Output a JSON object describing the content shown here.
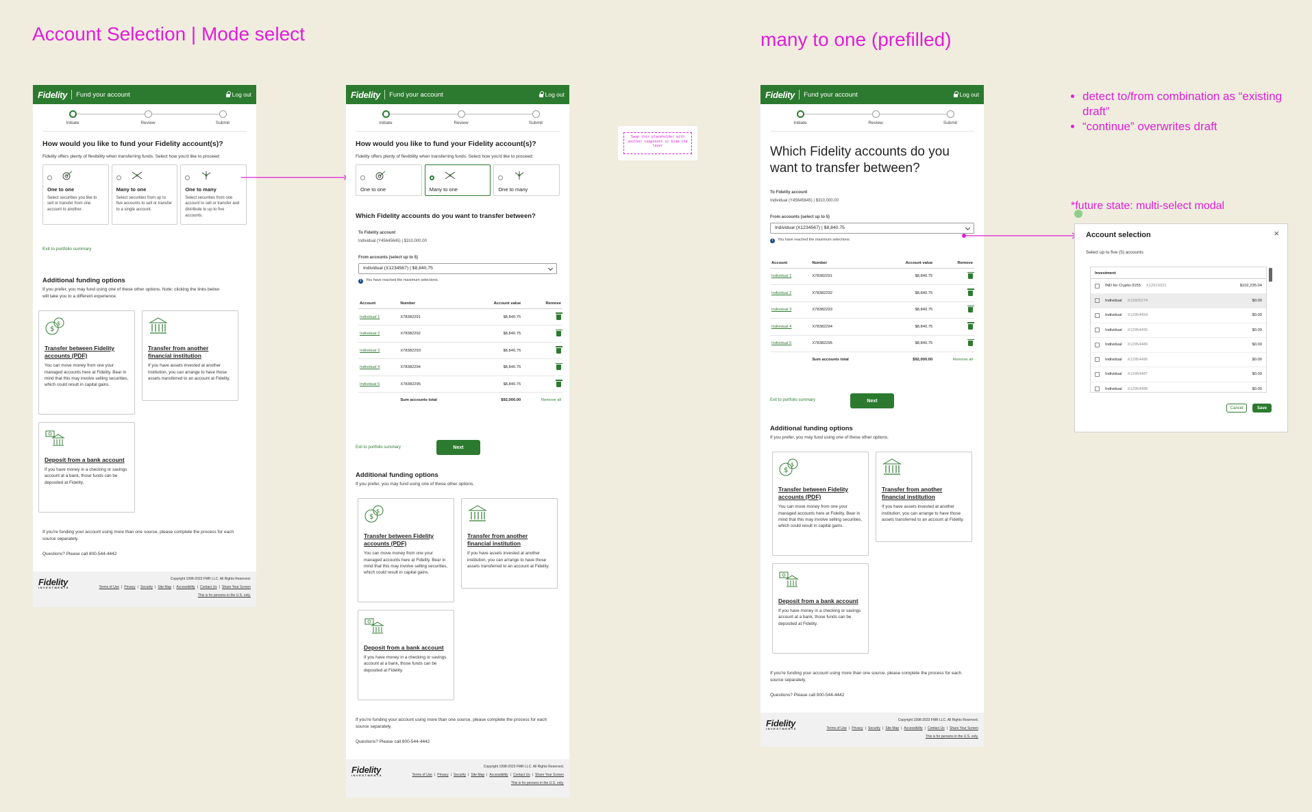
{
  "headings": {
    "left": "Account Selection | Mode select",
    "right": "many to one (prefilled)"
  },
  "header": {
    "brand": "Fidelity",
    "title": "Fund your account",
    "logout": "Log out"
  },
  "steps": [
    "Initiate",
    "Review",
    "Submit"
  ],
  "mode_select": {
    "question": "How would you like to fund your Fidelity account(s)?",
    "subtext": "Fidelity offers plenty of flexibility when transferring funds. Select how you'd like to proceed:",
    "modes": [
      {
        "title": "One to one",
        "desc": "Select securities you like to sell or transfer from one account to another."
      },
      {
        "title": "Many to one",
        "desc": "Select securities from up to five accounts to sell or transfer to a single account."
      },
      {
        "title": "One to many",
        "desc": "Select securities from one account to sell or transfer and distribute to up to five accounts."
      }
    ],
    "exit_link": "Exit to portfolio summary"
  },
  "additional": {
    "title": "Additional funding options",
    "subtext_long": "If you prefer, you may fund using one of these other options. Note: clicking the links below will take you to a different experience.",
    "subtext_short": "If you prefer, you may fund using one of these other options.",
    "cards": [
      {
        "title": "Transfer between Fidelity accounts (PDF)",
        "desc": "You can move money from one your managed accounts here at Fidelity. Bear in mind that this may involve selling securities, which could result in capital gains."
      },
      {
        "title": "Transfer from another financial institution",
        "desc": "If you have assets invested at another institution, you can arrange to have those assets transferred to an account at Fidelity."
      },
      {
        "title": "Deposit from a bank account",
        "desc": "If you have money in a checking or savings account at a bank, those funds can be deposited at Fidelity."
      }
    ],
    "multi_source": "If you're funding your account using more than one source, please complete the process for each source separately.",
    "questions": "Questions? Please call 800-544-4442"
  },
  "transfer": {
    "question": "Which Fidelity accounts do you want to transfer between?",
    "to_label": "To Fidelity account",
    "to_value": "Individual (Y45645645) | $310,000.00",
    "from_label": "From accounts (select up to 5)",
    "from_value": "Individual (X1234567) | $8,840.75",
    "max_note": "You have reached the maximum selections.",
    "columns": [
      "Account",
      "Number",
      "Account value",
      "Remove"
    ],
    "rows": [
      {
        "account": "Individual 1",
        "number": "X78382291",
        "value": "$8,840.75"
      },
      {
        "account": "Individual 2",
        "number": "X78382292",
        "value": "$8,840.75"
      },
      {
        "account": "Individual 3",
        "number": "X78382293",
        "value": "$8,840.75"
      },
      {
        "account": "Individual 4",
        "number": "X78382294",
        "value": "$8,840.75"
      },
      {
        "account": "Individual 5",
        "number": "X78382295",
        "value": "$8,840.75"
      }
    ],
    "sum_label": "Sum accounts total",
    "sum_value": "$92,000.00",
    "remove_all": "Remove all",
    "exit_link": "Exit to portfolio summary",
    "next": "Next"
  },
  "footer": {
    "brand": "Fidelity",
    "brand_sub": "INVESTMENTS",
    "copyright": "Copyright 1998-2023 FMR LLC. All Rights Reserved.",
    "links": [
      "Terms of Use",
      "Privacy",
      "Security",
      "Site Map",
      "Accessibility",
      "Contact Us",
      "Share Your Screen"
    ],
    "us_only": "This is for persons in the U.S. only."
  },
  "placeholder_note": "Swap this placeholder with another component or hide the layer",
  "notes": [
    "detect to/from combination as “existing draft”",
    "“continue” overwrites draft"
  ],
  "future_note": "*future state: multi-select modal",
  "modal": {
    "title": "Account selection",
    "subtitle": "Select up to five (5) accounts",
    "group": "Investment",
    "rows": [
      {
        "name": "IND for Crypto-3155",
        "number": "X12919321",
        "amount": "$102,235.04"
      },
      {
        "name": "Individual",
        "number": "X12926274",
        "amount": "$0.00"
      },
      {
        "name": "Individual",
        "number": "X12954454",
        "amount": "$0.00"
      },
      {
        "name": "Individual",
        "number": "X12954455",
        "amount": "$0.00"
      },
      {
        "name": "Individual",
        "number": "X12954480",
        "amount": "$0.00"
      },
      {
        "name": "Individual",
        "number": "X12954486",
        "amount": "$0.00"
      },
      {
        "name": "Individual",
        "number": "X12954487",
        "amount": "$0.00"
      },
      {
        "name": "Individual",
        "number": "X12954488",
        "amount": "$0.00"
      }
    ],
    "cancel": "Cancel",
    "save": "Save"
  },
  "colors": {
    "brand_green": "#2c7a2f",
    "annotation_magenta": "#e11dd8",
    "canvas": "#f0eddf"
  }
}
